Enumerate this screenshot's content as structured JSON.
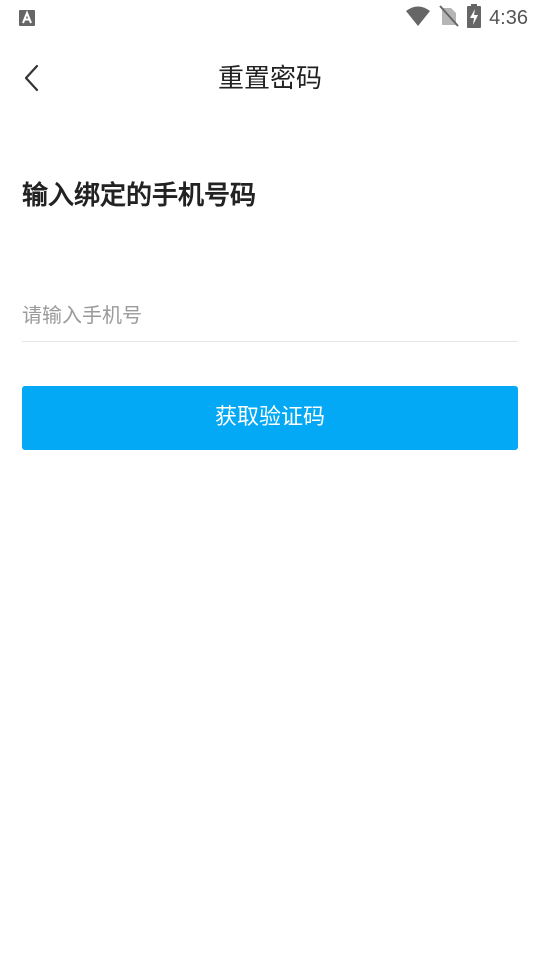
{
  "status_bar": {
    "time": "4:36",
    "icons": [
      "keyboard-a-icon",
      "wifi-icon",
      "no-sim-icon",
      "battery-charging-icon"
    ]
  },
  "header": {
    "back_icon": "back-arrow-icon",
    "title": "重置密码"
  },
  "form": {
    "heading": "输入绑定的手机号码",
    "phone_placeholder": "请输入手机号",
    "phone_value": "",
    "submit_label": "获取验证码"
  },
  "colors": {
    "accent": "#03a9f4",
    "background": "#ffffff",
    "text_primary": "#222222",
    "placeholder": "#9a9a9a",
    "divider": "#e6e6e6"
  }
}
